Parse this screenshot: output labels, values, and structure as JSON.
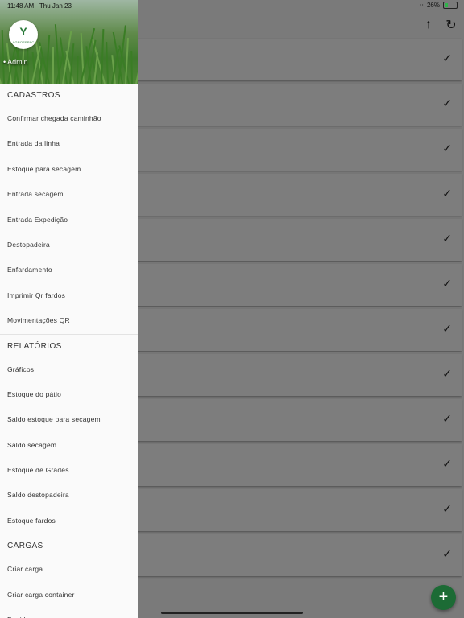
{
  "status_bar": {
    "time": "11:48 AM",
    "date": "Thu Jan 23",
    "battery": "26%",
    "battery_level": 0.26
  },
  "drawer": {
    "logo_text": "AGROSEPAC",
    "user_name": "Admin",
    "sections": [
      {
        "title": "CADASTROS",
        "items": [
          "Confirmar chegada caminhão",
          "Entrada da linha",
          "Estoque para secagem",
          "Entrada secagem",
          "Entrada Expedição",
          "Destopadeira",
          "Enfardamento",
          "Imprimir Qr fardos",
          "Movimentações QR"
        ]
      },
      {
        "title": "RELATÓRIOS",
        "items": [
          "Gráficos",
          "Estoque do pátio",
          "Saldo estoque para secagem",
          "Saldo secagem",
          "Estoque de Grades",
          "Saldo destopadeira",
          "Estoque fardos"
        ]
      },
      {
        "title": "CARGAS",
        "items": [
          "Criar carga",
          "Criar carga container",
          "Pedidos"
        ]
      }
    ]
  },
  "toolbar": {
    "icons": [
      "arrow-up-icon",
      "refresh-icon"
    ]
  },
  "list": {
    "row_count": 12,
    "row_status_icon": "check-icon"
  },
  "fab": {
    "icon": "plus-icon",
    "color": "#1c6b35"
  },
  "colors": {
    "scrim": "#7a7a7a",
    "drawer_bg": "#fafafa",
    "brand_green": "#2a7a3a"
  }
}
